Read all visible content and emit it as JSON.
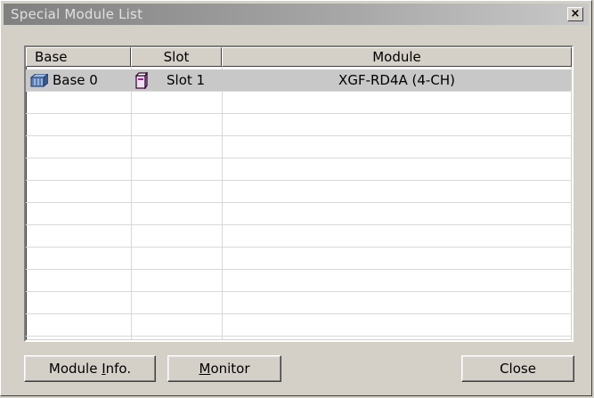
{
  "window": {
    "title": "Special Module List",
    "close_glyph": "×"
  },
  "list": {
    "columns": [
      "Base",
      "Slot",
      "Module"
    ],
    "rows": [
      {
        "base": "Base 0",
        "slot": "Slot 1",
        "module": "XGF-RD4A (4-CH)",
        "base_icon": "base-rack-icon",
        "slot_icon": "slot-module-icon"
      }
    ]
  },
  "buttons": {
    "module_info": {
      "pre": "Module ",
      "mnemonic": "I",
      "post": "nfo."
    },
    "monitor": {
      "pre": "",
      "mnemonic": "M",
      "post": "onitor"
    },
    "close": "Close"
  }
}
